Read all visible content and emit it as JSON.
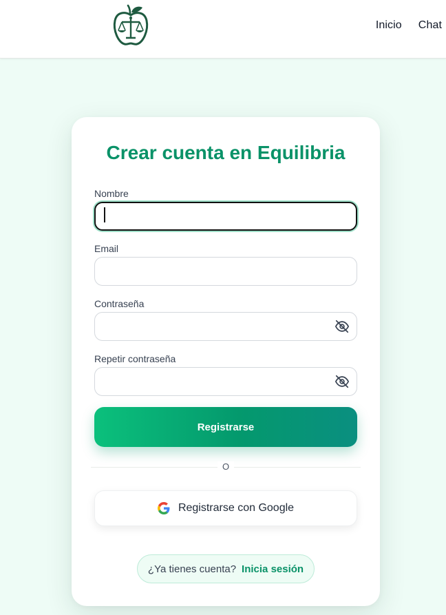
{
  "header": {
    "logo_icon": "apple-scales-logo",
    "nav": [
      {
        "label": "Inicio"
      },
      {
        "label": "Chat"
      }
    ]
  },
  "signup": {
    "title": "Crear cuenta en Equilibria",
    "fields": [
      {
        "label": "Nombre",
        "value": ""
      },
      {
        "label": "Email",
        "value": ""
      },
      {
        "label": "Contraseña",
        "value": "",
        "toggle_icon": "eye-off-icon"
      },
      {
        "label": "Repetir contraseña",
        "value": "",
        "toggle_icon": "eye-off-icon"
      }
    ],
    "submit_label": "Registrarse",
    "divider": "O",
    "google_label": "Registrarse con Google",
    "login_question": "¿Ya tienes cuenta?",
    "login_link": "Inicia sesión"
  },
  "colors": {
    "accent": "#0a9268",
    "background": "#eefcf6"
  }
}
